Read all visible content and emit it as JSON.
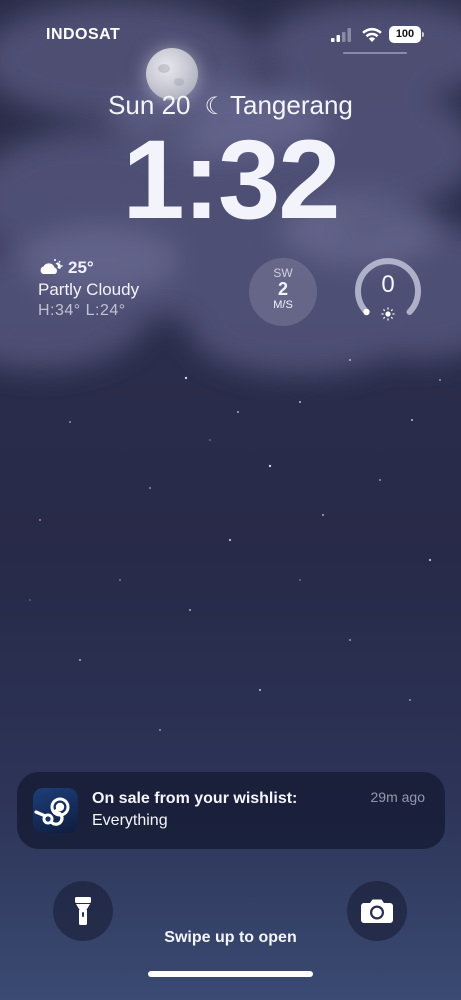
{
  "status": {
    "carrier": "INDOSAT",
    "battery": "100"
  },
  "lock": {
    "date": "Sun 20",
    "location": "Tangerang",
    "time": "1:32"
  },
  "weather": {
    "temp": "25°",
    "condition": "Partly Cloudy",
    "high_low": "H:34° L:24°"
  },
  "wind": {
    "direction": "SW",
    "value": "2",
    "unit": "M/S"
  },
  "uv_gauge": {
    "value": "0"
  },
  "notification": {
    "app_icon": "steam-icon",
    "title": "On sale from your wishlist:",
    "body": "Everything",
    "time": "29m ago"
  },
  "bottom": {
    "swipe_text": "Swipe up to open",
    "left_button_icon": "flashlight-icon",
    "right_button_icon": "camera-icon"
  }
}
